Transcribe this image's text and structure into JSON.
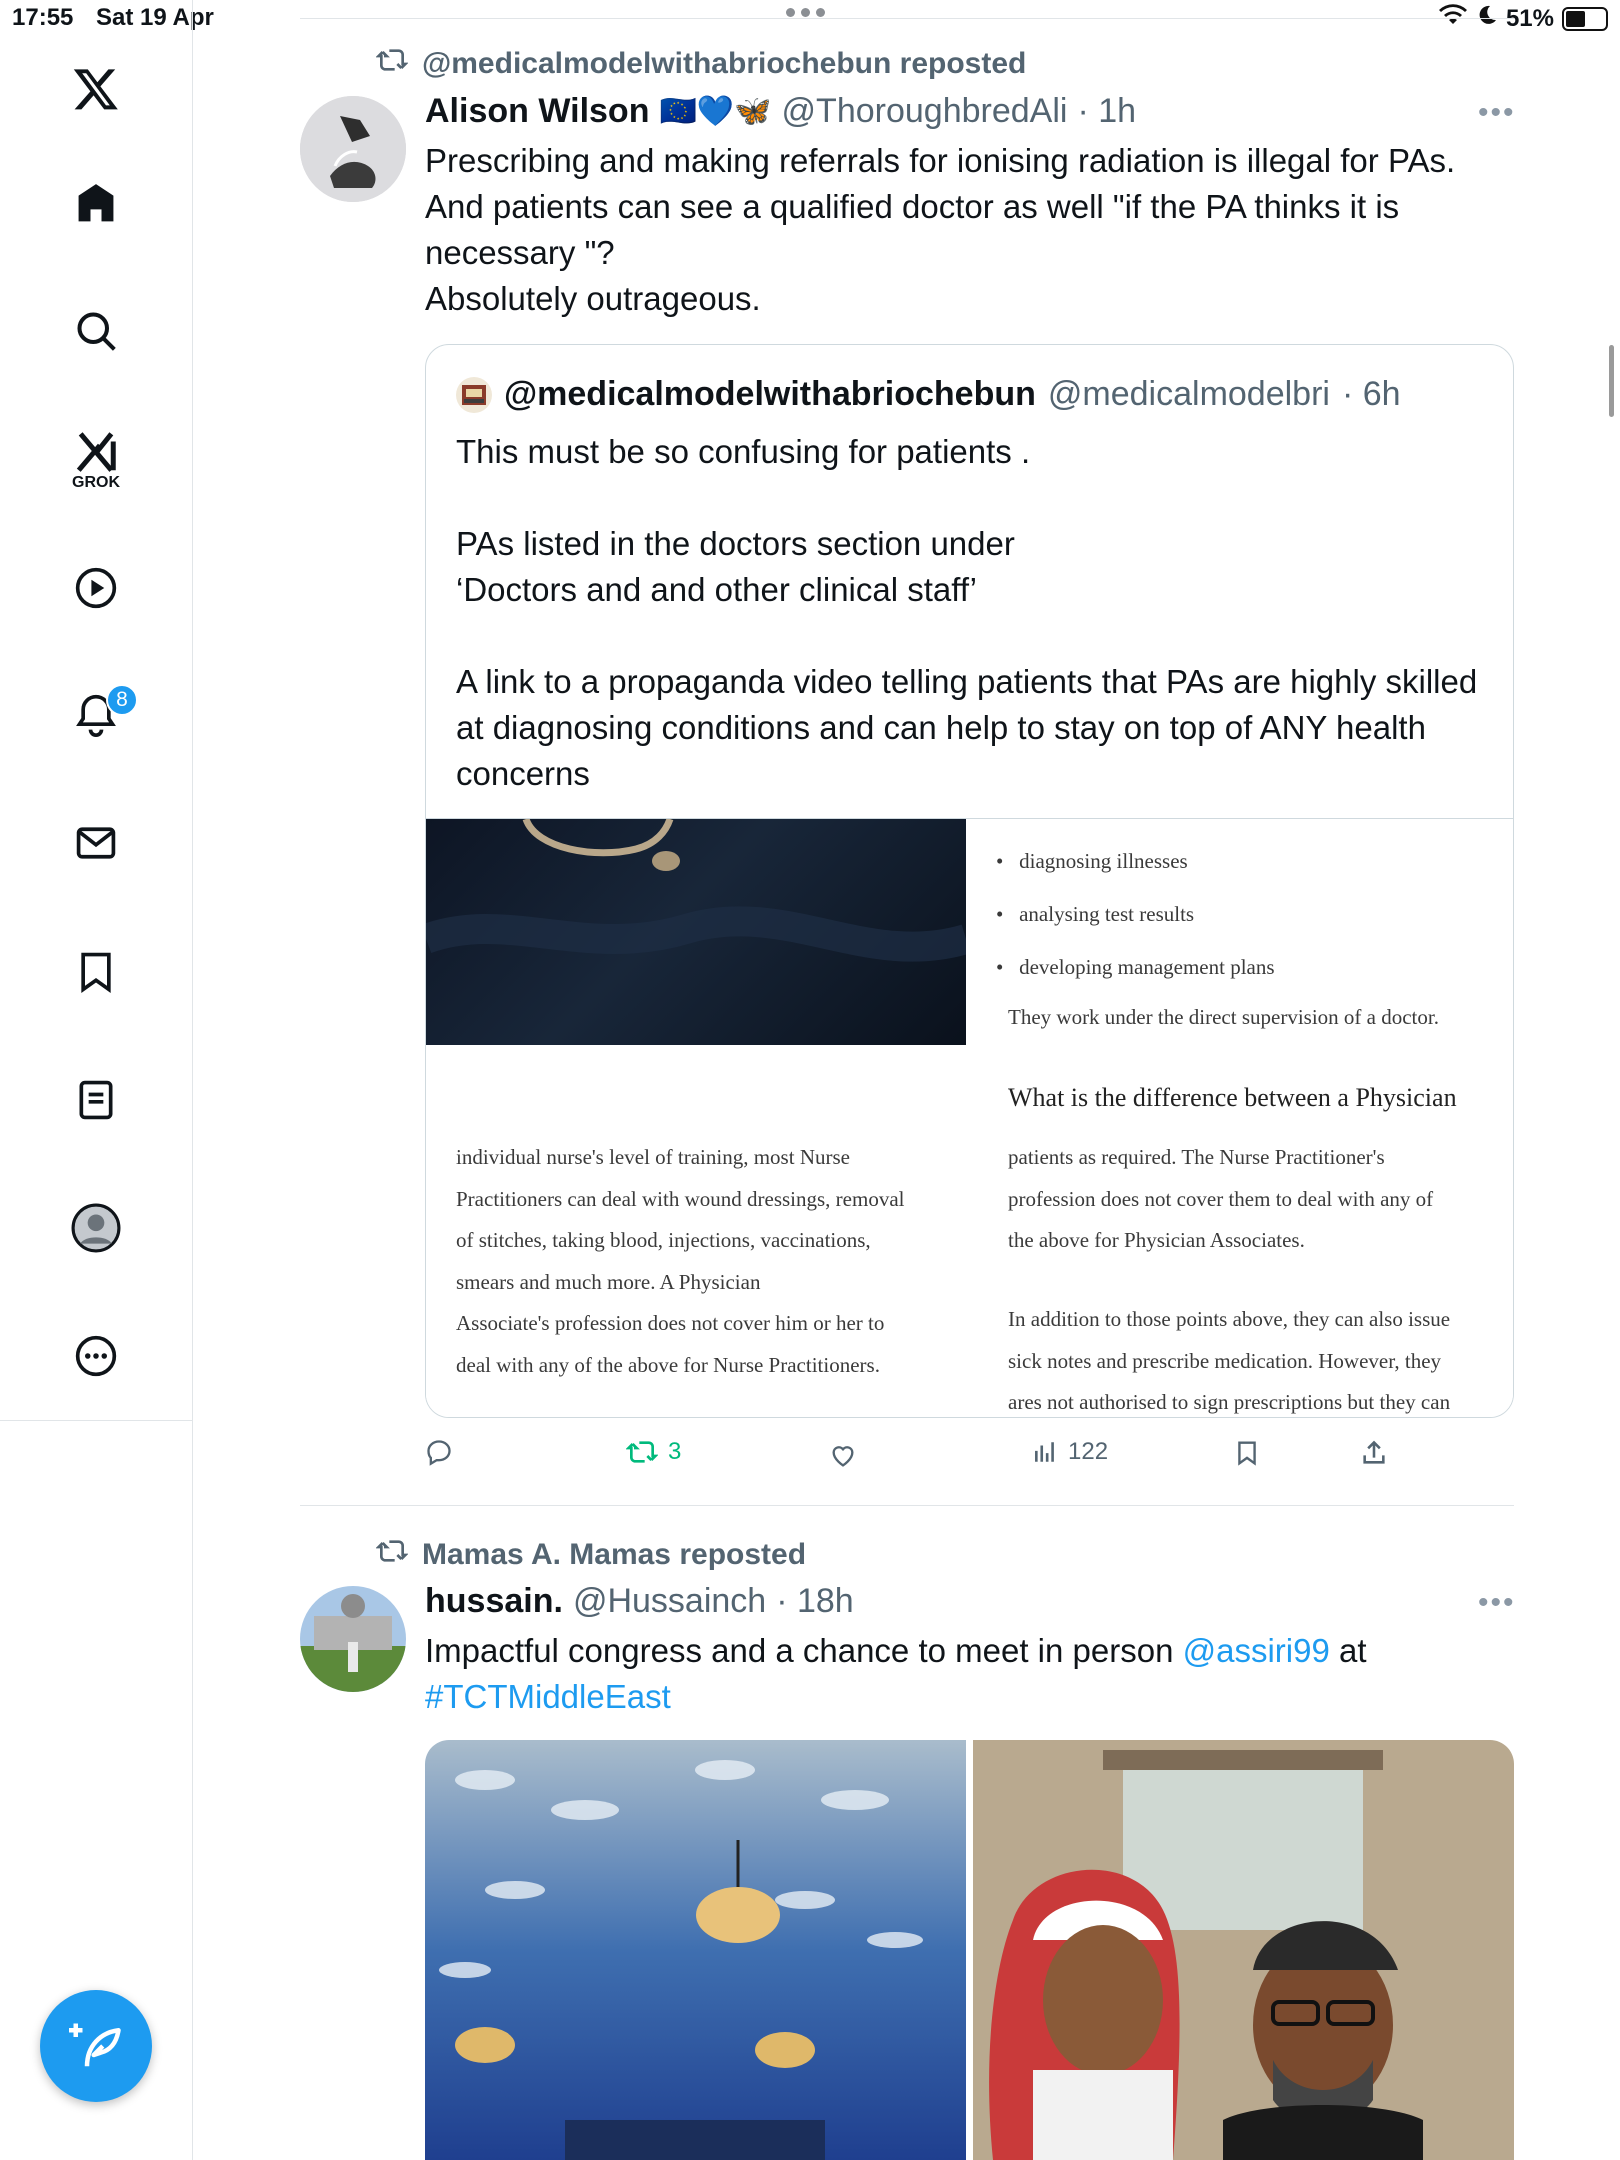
{
  "status": {
    "time": "17:55",
    "date": "Sat 19 Apr",
    "battery": "51%",
    "battery_level": 0.51
  },
  "sidebar": {
    "items": [
      "home",
      "explore",
      "grok",
      "videos",
      "notifications",
      "messages",
      "bookmarks",
      "lists",
      "profile",
      "more"
    ],
    "grok_label": "GROK",
    "notifications_badge": "8"
  },
  "tweet1": {
    "reposted_by": "@medicalmodelwithabriochebun reposted",
    "author_name": "Alison Wilson",
    "author_emoji": "🇪🇺💙🦋",
    "handle": "@ThoroughbredAli",
    "time": "· 1h",
    "text": "Prescribing and making referrals for ionising radiation is illegal for PAs.\nAnd patients can see a qualified doctor as well \"if the PA thinks it is necessary \"?\nAbsolutely outrageous.",
    "quote": {
      "name": "@medicalmodelwithabriochebun",
      "handle": "@medicalmodelbri",
      "time": "· 6h",
      "text": "This must be so confusing for patients .\n\nPAs listed in the doctors section under\n‘Doctors and and other clinical staff’\n\nA link to a propaganda video telling patients that PAs are highly skilled at diagnosing conditions and can help to stay on top of ANY health concerns",
      "doc": {
        "bullets": [
          "diagnosing illnesses",
          "analysing test results",
          "developing management plans"
        ],
        "supervision": "They work under the direct supervision of a doctor.",
        "heading": "What is the difference between a Physician",
        "left_para": [
          "individual nurse's level of training, most Nurse",
          "Practitioners can deal with wound dressings, removal",
          "of stitches, taking blood, injections, vaccinations,",
          "smears and much more. A Physician",
          "Associate's profession does not cover him or her to",
          "deal with any of the above for Nurse Practitioners."
        ],
        "right_para1": [
          "patients as required. The Nurse Practitioner's",
          "profession does not cover them to deal with any of",
          "the above for Physician Associates."
        ],
        "right_para2": [
          "In addition to those points above, they can also issue",
          "sick notes and prescribe medication. However, they",
          "ares not authorised to sign prescriptions but they can"
        ]
      }
    },
    "actions": {
      "replies": "",
      "reposts": "3",
      "likes": "",
      "views": "122"
    }
  },
  "tweet2": {
    "reposted_by": "Mamas A. Mamas reposted",
    "author_name": "hussain.",
    "handle": "@Hussainch",
    "time": "· 18h",
    "text_before": "Impactful congress and a chance to meet in person ",
    "mention": "@assiri99",
    "text_after": " at",
    "hashtag": "#TCTMiddleEast"
  },
  "colors": {
    "accent": "#1d9bf0",
    "repost_green": "#00ba7c",
    "muted": "#536471"
  }
}
